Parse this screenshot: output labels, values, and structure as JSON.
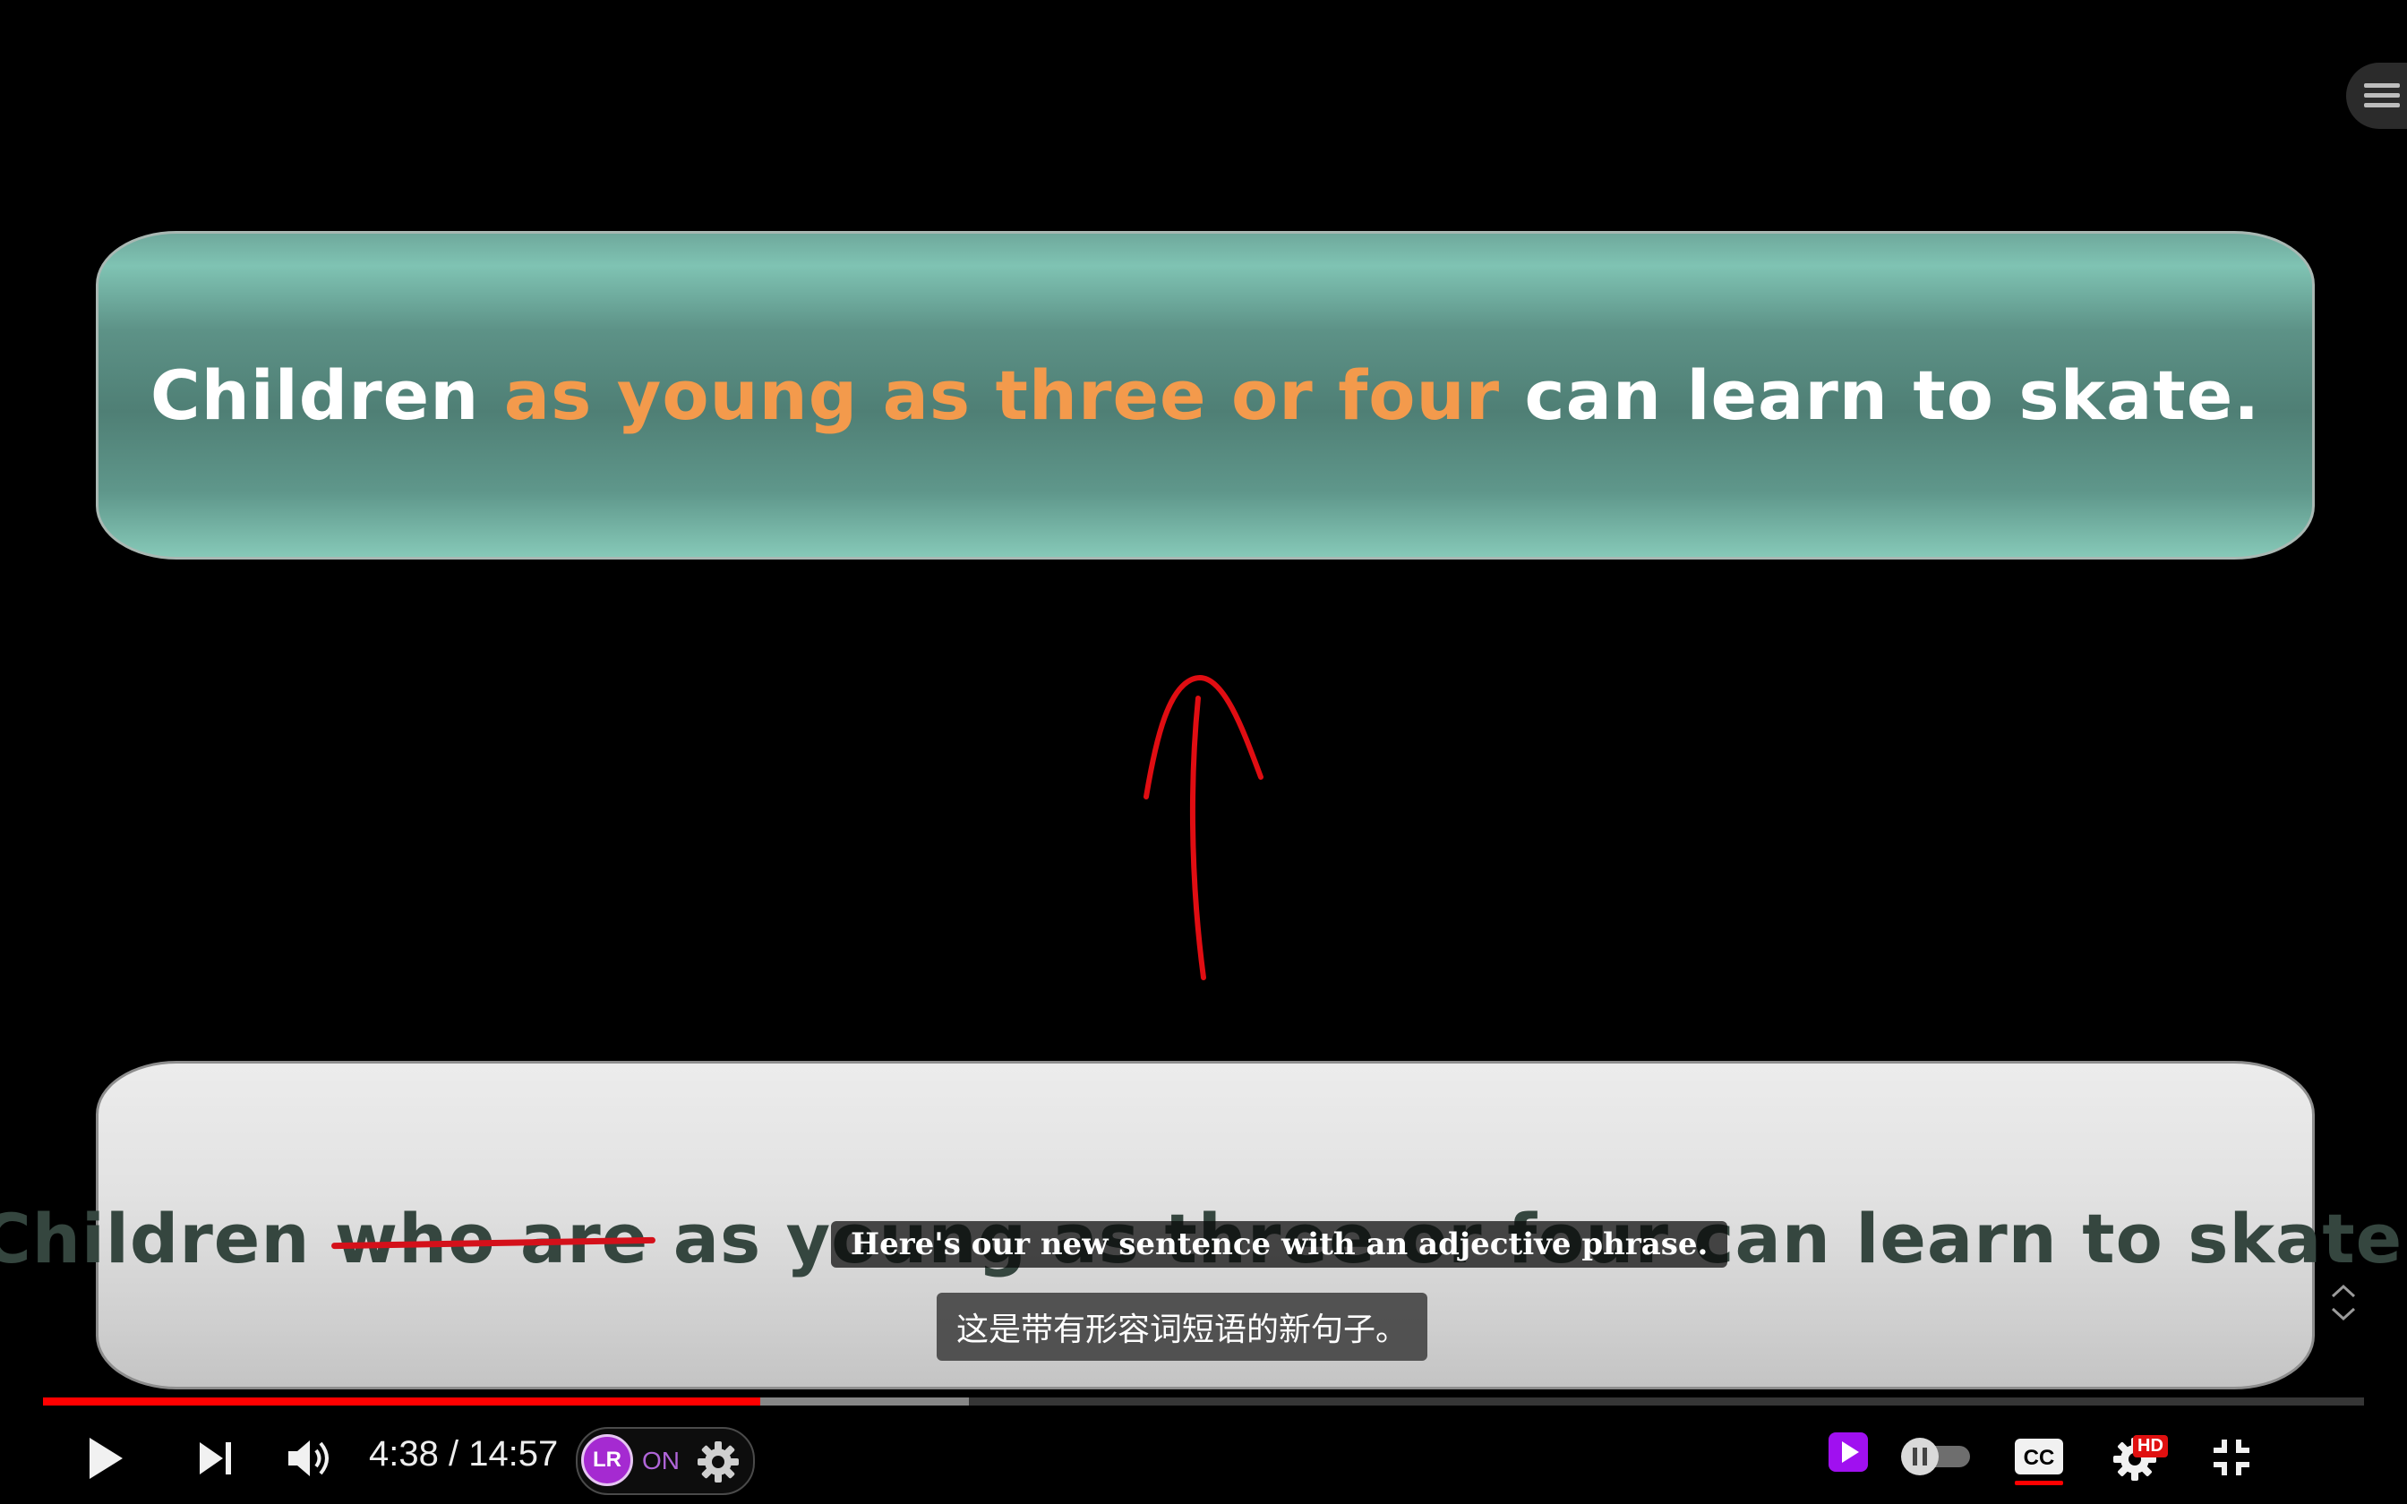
{
  "video": {
    "top_banner": {
      "before": "Children ",
      "highlight": "as young as three or four",
      "after": " can learn to skate."
    },
    "bottom_banner": {
      "start": "Children ",
      "struck": "who are",
      "rest": " as young as three or four can learn to skate."
    }
  },
  "subtitles": {
    "english": "Here's our new sentence with an adjective phrase.",
    "chinese": "这是带有形容词短语的新句子。"
  },
  "player": {
    "current_time": "4:38",
    "duration": "14:57",
    "time_display": "4:38 / 14:57",
    "progress_fraction": 0.309,
    "buffered_fraction": 0.399,
    "lr_label": "ON",
    "lr_logo_text": "LR",
    "hd_badge": "HD",
    "colors": {
      "progress": "#ff0000",
      "highlight": "#f39a4c",
      "lr_accent": "#a52ad1"
    },
    "icons": [
      "play-icon",
      "next-icon",
      "volume-icon",
      "settings-icon",
      "miniplayer-icon",
      "autoplay-toggle-icon",
      "captions-icon",
      "quality-settings-icon",
      "exit-fullscreen-icon",
      "menu-icon"
    ]
  }
}
